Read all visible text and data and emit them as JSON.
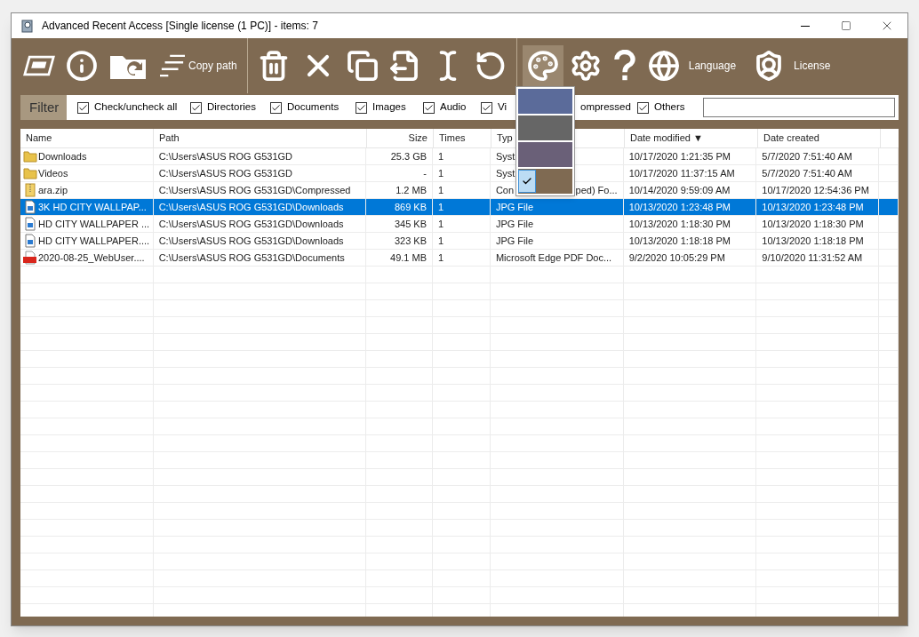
{
  "window": {
    "title": "Advanced Recent Access [Single license (1 PC)] - items: 7"
  },
  "toolbar": {
    "buttons": [
      {
        "selected": false
      },
      {
        "selected": false
      },
      {
        "selected": false
      },
      {
        "selected": false,
        "label": "Copy path"
      },
      {
        "selected": false
      },
      {
        "selected": false
      },
      {
        "selected": false
      },
      {
        "selected": false
      },
      {
        "selected": false
      },
      {
        "selected": false
      },
      {
        "selected": true
      },
      {
        "selected": false
      },
      {
        "selected": false
      },
      {
        "selected": false,
        "label": "Language"
      },
      {
        "selected": false,
        "label": "License"
      }
    ]
  },
  "theme_menu": [
    {
      "color": "#5b6b9a",
      "selected": false
    },
    {
      "color": "#666666",
      "selected": false
    },
    {
      "color": "#6a6078",
      "selected": false
    },
    {
      "color": "#7f6a52",
      "selected": true
    }
  ],
  "filter": {
    "label": "Filter",
    "options": [
      {
        "label": "Check/uncheck all",
        "checked": true
      },
      {
        "label": "Directories",
        "checked": true
      },
      {
        "label": "Documents",
        "checked": true
      },
      {
        "label": "Images",
        "checked": true
      },
      {
        "label": "Audio",
        "checked": true
      },
      {
        "label": "Vi",
        "checked": true
      },
      {
        "label": "ompressed"
      },
      {
        "label": "Others",
        "checked": true
      }
    ]
  },
  "table": {
    "columns": [
      "Name",
      "Path",
      "Size",
      "Times",
      "Typ",
      "Date modified ▼",
      "Date created"
    ],
    "rows": [
      {
        "kind": "folder",
        "selected": false,
        "cells": [
          "Downloads",
          "C:\\Users\\ASUS ROG G531GD",
          "25.3 GB",
          "1",
          [
            "Syst"
          ],
          "10/17/2020 1:21:35 PM",
          "5/7/2020 7:51:40 AM"
        ]
      },
      {
        "kind": "folder",
        "selected": false,
        "cells": [
          "Videos",
          "C:\\Users\\ASUS ROG G531GD",
          "-",
          "1",
          [
            "Syst"
          ],
          "10/17/2020 11:37:15 AM",
          "5/7/2020 7:51:40 AM"
        ]
      },
      {
        "kind": "zip",
        "selected": false,
        "cells": [
          "ara.zip",
          "C:\\Users\\ASUS ROG G531GD\\Compressed",
          "1.2 MB",
          "1",
          [
            "Con",
            "ped) Fo..."
          ],
          "10/14/2020 9:59:09 AM",
          "10/17/2020 12:54:36 PM"
        ]
      },
      {
        "kind": "image",
        "selected": true,
        "cells": [
          "3K HD CITY WALLPAP...",
          "C:\\Users\\ASUS ROG G531GD\\Downloads",
          "869 KB",
          "1",
          "JPG File",
          "10/13/2020 1:23:48 PM",
          "10/13/2020 1:23:48 PM"
        ]
      },
      {
        "kind": "image",
        "selected": false,
        "cells": [
          "HD CITY WALLPAPER ...",
          "C:\\Users\\ASUS ROG G531GD\\Downloads",
          "345 KB",
          "1",
          "JPG File",
          "10/13/2020 1:18:30 PM",
          "10/13/2020 1:18:30 PM"
        ]
      },
      {
        "kind": "image",
        "selected": false,
        "cells": [
          "HD CITY WALLPAPER....",
          "C:\\Users\\ASUS ROG G531GD\\Downloads",
          "323 KB",
          "1",
          "JPG File",
          "10/13/2020 1:18:18 PM",
          "10/13/2020 1:18:18 PM"
        ]
      },
      {
        "kind": "pdf",
        "selected": false,
        "cells": [
          "2020-08-25_WebUser....",
          "C:\\Users\\ASUS ROG G531GD\\Documents",
          "49.1 MB",
          "1",
          "Microsoft Edge PDF Doc...",
          "9/2/2020 10:05:29 PM",
          "9/10/2020 11:31:52 AM"
        ]
      }
    ]
  }
}
